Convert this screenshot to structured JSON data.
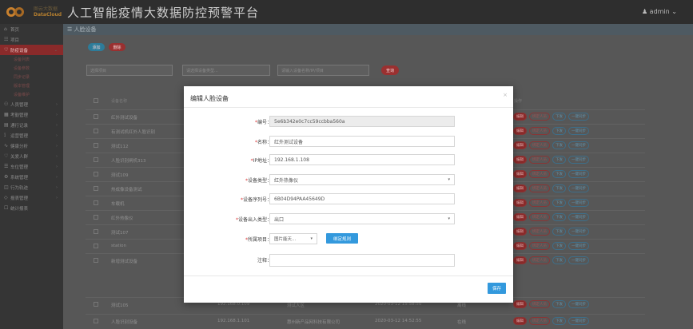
{
  "header": {
    "brand_line1": "图云大数据",
    "brand_line2": "DataCloud",
    "title": "人工智能疫情大数据防控预警平台",
    "user": "♟ admin ⌄"
  },
  "sidebar": {
    "items": [
      {
        "label": "首页",
        "icon": "⌂"
      },
      {
        "label": "项目",
        "icon": "☷"
      },
      {
        "label": "防疫设备",
        "icon": "♡",
        "active": true
      },
      {
        "label": "人员管理",
        "icon": "⚇"
      },
      {
        "label": "考勤管理",
        "icon": "▦"
      },
      {
        "label": "通行记录",
        "icon": "▤"
      },
      {
        "label": "运营管理",
        "icon": "⟟"
      },
      {
        "label": "健康分析",
        "icon": "∿"
      },
      {
        "label": "关爱人群",
        "icon": "♡"
      },
      {
        "label": "车位管理",
        "icon": "☰"
      },
      {
        "label": "系统管理",
        "icon": "⚙"
      },
      {
        "label": "行为轨迹",
        "icon": "◫"
      },
      {
        "label": "报表管理",
        "icon": "◇"
      },
      {
        "label": "统计报表",
        "icon": "☐"
      }
    ],
    "subitems": [
      "设备列表",
      "设备参数",
      "同步记录",
      "版本管理",
      "设备维护"
    ]
  },
  "main": {
    "breadcrumb": "☰ 人脸设备",
    "add_label": "添加",
    "delete_label": "删除",
    "filter1": "选择项目",
    "filter2": "请选择设备类型...",
    "filter3": "请输入设备名称/IP/项目",
    "search_label": "查询",
    "col_name": "设备名称",
    "col_ops": "操作",
    "rows": [
      {
        "name": "红外测试设备",
        "c2": "",
        "c3": "",
        "c4": "",
        "c5": ""
      },
      {
        "name": "有测试机红外人脸识别",
        "c2": "",
        "c3": "",
        "c4": "",
        "c5": ""
      },
      {
        "name": "测试112",
        "c2": "",
        "c3": "",
        "c4": "",
        "c5": ""
      },
      {
        "name": "人脸识别闸机313",
        "c2": "",
        "c3": "",
        "c4": "",
        "c5": ""
      },
      {
        "name": "测试109",
        "c2": "",
        "c3": "",
        "c4": "",
        "c5": ""
      },
      {
        "name": "热成像设备测试",
        "c2": "",
        "c3": "",
        "c4": "",
        "c5": ""
      },
      {
        "name": "车载机",
        "c2": "",
        "c3": "",
        "c4": "",
        "c5": ""
      },
      {
        "name": "红外热像仪",
        "c2": "",
        "c3": "",
        "c4": "",
        "c5": ""
      },
      {
        "name": "测试107",
        "c2": "",
        "c3": "",
        "c4": "",
        "c5": ""
      },
      {
        "name": "station",
        "c2": "",
        "c3": "",
        "c4": "",
        "c5": ""
      },
      {
        "name": "新增测试设备",
        "c2": "",
        "c3": "",
        "c4": "",
        "c5": ""
      },
      {
        "name": "测试105",
        "c2": "192.168.0.109",
        "c3": "测试大区",
        "c4": "2020-03-12 15:58:50",
        "c5": "离线"
      },
      {
        "name": "人脸识别设备",
        "c2": "192.168.1.101",
        "c3": "惠州新产品网科技有限公司",
        "c4": "2020-03-12 14:52:55",
        "c5": "在线"
      }
    ],
    "ops": [
      "编辑",
      "绑定人员",
      "下发",
      "一键同步"
    ]
  },
  "modal": {
    "title": "编辑人脸设备",
    "close": "×",
    "fields": [
      {
        "label": "编号：",
        "value": "5e6b342e0c7cc59ccbba560a",
        "disabled": true
      },
      {
        "label": "名称：",
        "value": "红外测试设备"
      },
      {
        "label": "IP地址：",
        "value": "192.168.1.108"
      },
      {
        "label": "设备类型：",
        "value": "红外热像仪",
        "select": true
      },
      {
        "label": "设备序列号：",
        "value": "6B04D94PAA45649D"
      },
      {
        "label": "设备出入类型：",
        "value": "出口",
        "select": true
      },
      {
        "label": "所属项目：",
        "value": ""
      },
      {
        "label": "注释：",
        "value": ""
      }
    ],
    "project_select": "图片能天...",
    "project_caret": "▾",
    "bind_label": "绑定规则",
    "save_label": "保存"
  }
}
